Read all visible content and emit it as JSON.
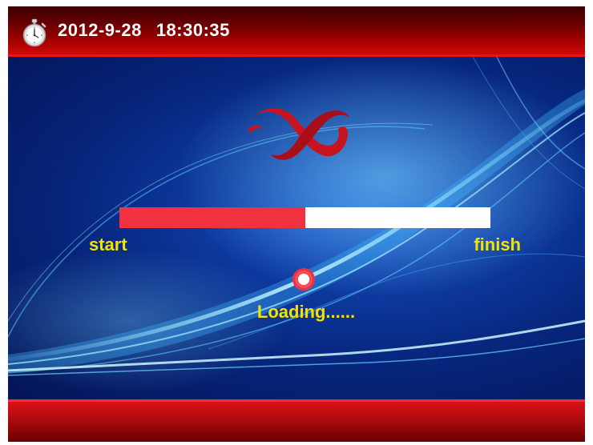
{
  "header": {
    "date": "2012-9-28",
    "time": "18:30:35",
    "icon": "stopwatch-icon"
  },
  "logo": {
    "icon": "brand-logo-icon",
    "color": "#c8141e"
  },
  "progress": {
    "value": 0.5,
    "start_label": "start",
    "finish_label": "finish",
    "fill_color": "#ef3140",
    "track_color": "#ffffff"
  },
  "status": {
    "text": "Loading......",
    "indicator_icon": "loading-dot-icon",
    "text_color": "#f4e200"
  },
  "colors": {
    "header_red": "#a80000",
    "background_blue": "#0d3aa0"
  }
}
